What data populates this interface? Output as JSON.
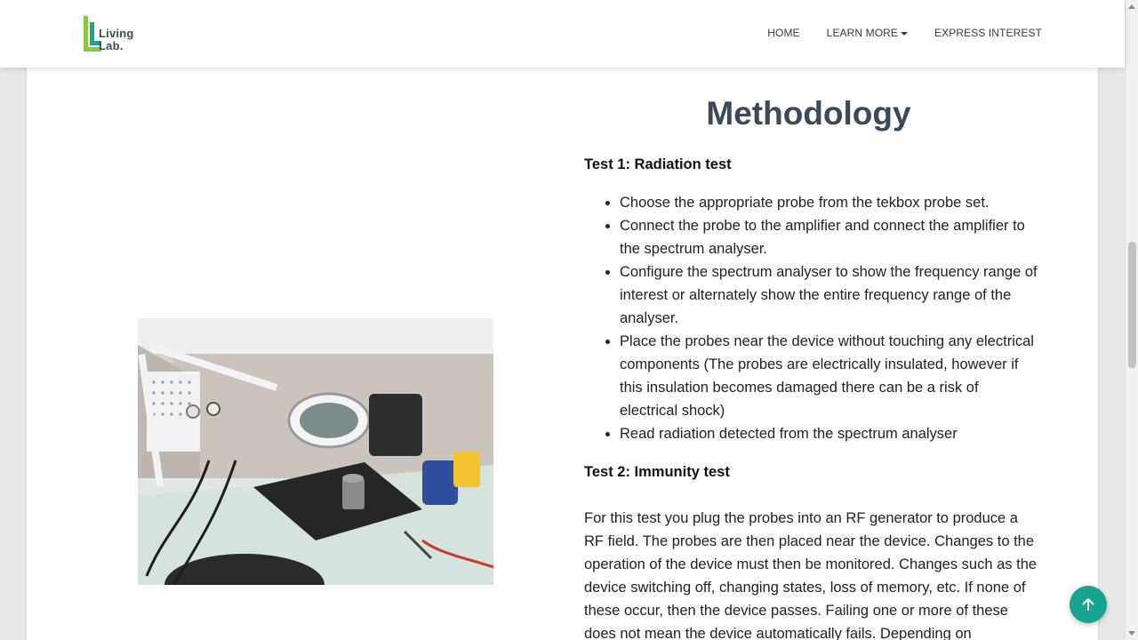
{
  "brand": {
    "line1": "Living",
    "line2": "Lab."
  },
  "nav": {
    "items": [
      "HOME",
      "LEARN MORE",
      "EXPRESS INTEREST"
    ]
  },
  "content": {
    "title": "Methodology",
    "test1_heading": "Test 1: Radiation test",
    "test1_steps": [
      "Choose the appropriate probe from the tekbox probe set.",
      "Connect the probe to the amplifier and connect the amplifier to the spectrum analyser.",
      "Configure the spectrum analyser to show the frequency range of interest or alternately show the entire frequency range of the analyser.",
      "Place the probes near the device without touching any electrical components (The probes are electrically insulated, however if this insulation becomes damaged there can be a risk of electrical shock)",
      "Read radiation detected from the spectrum analyser"
    ],
    "test2_heading": "Test 2: Immunity test",
    "test2_paragraph": "For this test you plug the probes into an RF generator to produce a RF field. The probes are then placed near the device. Changes to the operation of the device must then be monitored. Changes such as the device switching off, changing states, loss of memory, etc. If none of these occur, then the device passes. Failing one or more of these does not mean the device automatically fails. Depending on"
  },
  "colors": {
    "accent": "#1aa38e",
    "title": "#3b4a5a"
  },
  "icons": {
    "back_to_top": "arrow-up-icon"
  }
}
